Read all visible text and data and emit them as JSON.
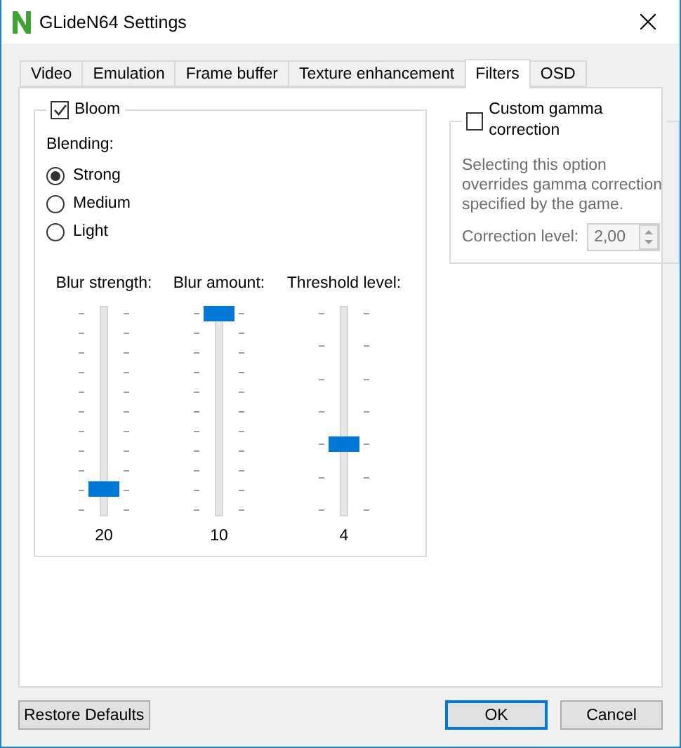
{
  "window": {
    "title": "GLideN64 Settings"
  },
  "tabs": [
    {
      "label": "Video",
      "selected": false
    },
    {
      "label": "Emulation",
      "selected": false
    },
    {
      "label": "Frame buffer",
      "selected": false
    },
    {
      "label": "Texture enhancement",
      "selected": false
    },
    {
      "label": "Filters",
      "selected": true
    },
    {
      "label": "OSD",
      "selected": false
    }
  ],
  "bloom": {
    "label": "Bloom",
    "checked": true,
    "blending_label": "Blending:",
    "blending_options": [
      {
        "label": "Strong",
        "selected": true
      },
      {
        "label": "Medium",
        "selected": false
      },
      {
        "label": "Light",
        "selected": false
      }
    ],
    "sliders": [
      {
        "label": "Blur strength:",
        "kind": "ten_steps",
        "level": 0.1,
        "reading": "20"
      },
      {
        "label": "Blur amount:",
        "kind": "ten_steps",
        "level": 1,
        "reading": "10"
      },
      {
        "label": "Threshold level:",
        "kind": "six_steps",
        "level": 0.333,
        "reading": "4"
      }
    ]
  },
  "gamma": {
    "label": "Custom gamma correction",
    "checked": false,
    "disabled": true,
    "description": "Selecting this option overrides gamma correction specified by the game.",
    "correction_label": "Correction level:",
    "correction_value": "2,00"
  },
  "buttons": [
    {
      "label": "Restore Defaults",
      "default": false
    },
    {
      "label": "OK",
      "default": true
    },
    {
      "label": "Cancel",
      "default": false
    }
  ]
}
